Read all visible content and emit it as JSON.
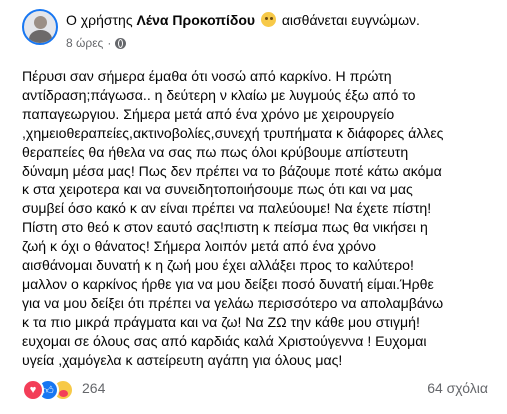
{
  "header": {
    "prefix": "Ο χρήστης",
    "author_name": "Λένα Προκοπίδου",
    "feeling_icon": "smiling-face-icon",
    "feeling_text": "αισθάνεται ευγνώμων.",
    "timestamp": "8 ώρες",
    "separator": "·",
    "privacy_icon": "globe-icon"
  },
  "post": {
    "lines": [
      "Πέρυσι σαν σήμερα έμαθα ότι νοσώ από καρκίνο. Η πρώτη",
      "αντίδραση;πάγωσα.. η δεύτερη ν κλαίω με λυγμούς έξω από το",
      "παπαγεωργιου. Σήμερα μετά από ένα χρόνο με χειρουργείο",
      ",χημειοθεραπείες,ακτινοβολίες,συνεχή τρυπήματα κ διάφορες άλλες",
      "θεραπείες θα ήθελα να σας πω πως όλοι κρύβουμε απίστευτη",
      "δύναμη μέσα μας! Πως δεν πρέπει να το βάζουμε ποτέ κάτω ακόμα",
      "κ στα χειροτερα και να συνειδητοποιήσουμε πως ότι και να μας",
      "συμβεί όσο κακό κ αν είναι πρέπει να παλεύουμε! Να έχετε πίστη!",
      "Πίστη στο θεό κ στον εαυτό σας!πιστη κ πείσμα πως θα νικήσει η",
      "ζωή κ όχι ο θάνατος! Σήμερα λοιπόν μετά από ένα χρόνο",
      "αισθάνομαι δυνατή κ η ζωή μου έχει αλλάξει προς το καλύτερο!",
      "μαλλον ο καρκίνος ήρθε για να μου δείξει ποσό δυνατή είμαι.Ήρθε",
      "για να μου δείξει ότι πρέπει να γελάω περισσότερο να απολαμβάνω",
      "κ τα πιο μικρά πράγματα και να ζω! Να ΖΩ την κάθε μου στιγμή!",
      "ευχομαι σε όλους σας από καρδιάς καλά Χριστούγεννα ! Ευχομαι",
      "υγεία ,χαμόγελα κ αστείρευτη αγάπη για όλους μας!"
    ]
  },
  "footer": {
    "reaction_icons": [
      "love-reaction-icon",
      "like-reaction-icon",
      "care-reaction-icon"
    ],
    "reaction_count": "264",
    "comments_text": "64 σχόλια"
  },
  "colors": {
    "accent": "#1877f2",
    "secondary_text": "#65676b",
    "love": "#f33e58",
    "care": "#f7c948"
  }
}
